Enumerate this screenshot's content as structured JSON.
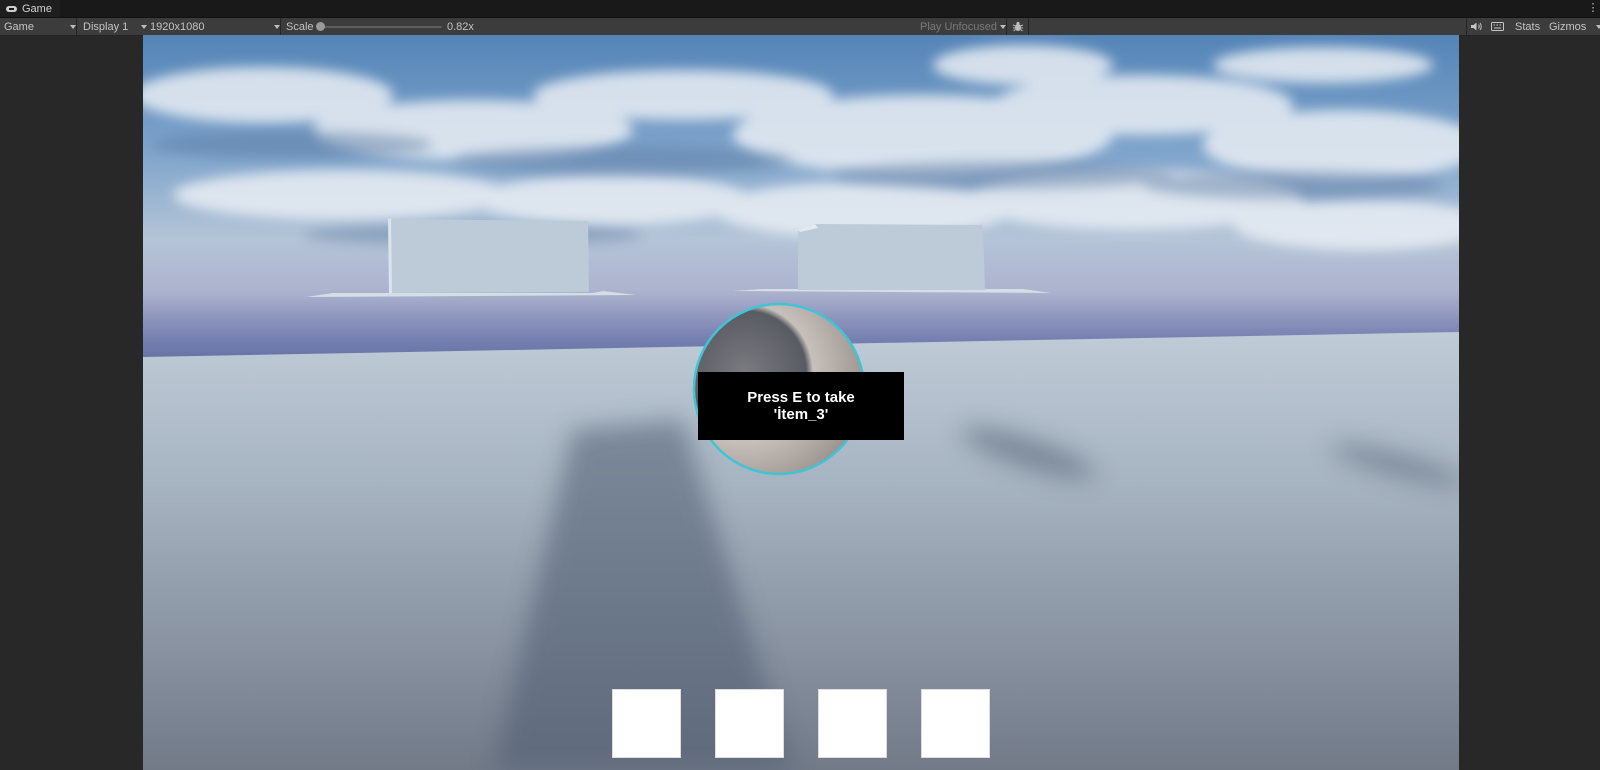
{
  "window": {
    "tab_title": "Game",
    "tab_icon": "gamepad-icon"
  },
  "toolbar": {
    "view_mode": "Game",
    "display": "Display 1",
    "resolution": "1920x1080",
    "scale_label": "Scale",
    "scale_value": "0.82x",
    "play_mode": "Play Unfocused",
    "stats_label": "Stats",
    "gizmos_label": "Gizmos"
  },
  "game": {
    "prompt_line1": "Press E to take",
    "prompt_line2": "'İtem_3'",
    "inventory_slots": 4
  },
  "colors": {
    "editor_bg": "#282828",
    "toolbar_bg": "#3c3c3c",
    "outline": "#3fc4d6",
    "prompt_bg": "#000000",
    "slot": "#ffffff"
  }
}
